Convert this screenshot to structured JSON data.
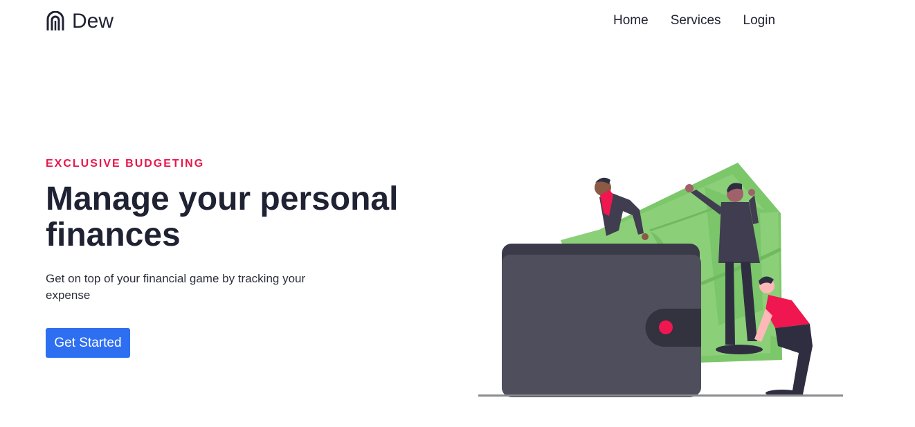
{
  "header": {
    "brand_name": "Dew",
    "nav": {
      "home": "Home",
      "services": "Services",
      "login": "Login"
    }
  },
  "hero": {
    "eyebrow": "EXCLUSIVE BUDGETING",
    "headline": "Manage your personal finances",
    "subtext": "Get on top of your financial game by tracking your expense",
    "cta_label": "Get Started"
  },
  "icons": {
    "brand_logo": "dew-logo-icon",
    "illustration": "wallet-money-people-illustration"
  },
  "colors": {
    "accent": "#e8164a",
    "primary_button": "#2e6ff2",
    "text_dark": "#1f2233",
    "money_green": "#7dc76b",
    "wallet_gray": "#4f4e5d"
  }
}
